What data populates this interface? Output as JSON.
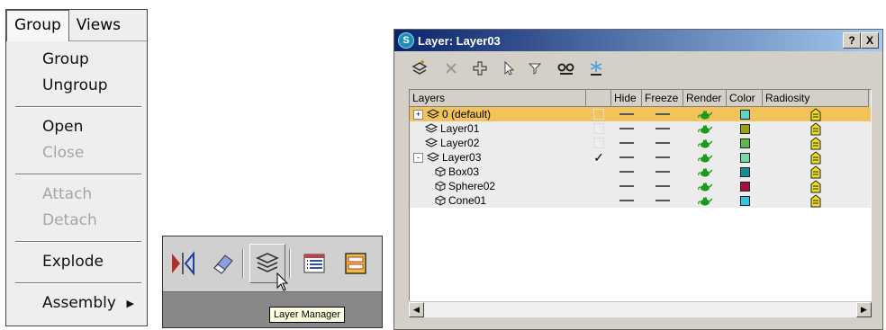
{
  "menu": {
    "bar": [
      "Group",
      "Views"
    ],
    "items": [
      {
        "label": "Group",
        "disabled": false
      },
      {
        "label": "Ungroup",
        "disabled": false
      },
      {
        "label": "Open",
        "disabled": false
      },
      {
        "label": "Close",
        "disabled": true
      },
      {
        "label": "Attach",
        "disabled": true
      },
      {
        "label": "Detach",
        "disabled": true
      },
      {
        "label": "Explode",
        "disabled": false
      },
      {
        "label": "Assembly",
        "disabled": false,
        "submenu": true
      }
    ]
  },
  "toolbar": {
    "buttons": [
      "mirror-icon",
      "eraser-icon",
      "layer-manager-icon",
      "list-view-icon",
      "window-icon"
    ],
    "tooltip": "Layer Manager"
  },
  "dialog": {
    "title": "Layer: Layer03",
    "title_buttons": [
      "?",
      "X"
    ],
    "tools": [
      "new-layer-icon",
      "delete-icon",
      "add-selection-icon",
      "select-icon",
      "highlight-icon",
      "hide-all-icon",
      "freeze-all-icon"
    ],
    "columns": [
      "Layers",
      "",
      "Hide",
      "Freeze",
      "Render",
      "Color",
      "Radiosity"
    ],
    "rows": [
      {
        "name": "0 (default)",
        "level": 0,
        "expander": "+",
        "selected": true,
        "current": false,
        "color": "#5ad6c8"
      },
      {
        "name": "Layer01",
        "level": 0,
        "expander": "",
        "selected": false,
        "current": false,
        "color": "#9aa01c"
      },
      {
        "name": "Layer02",
        "level": 0,
        "expander": "",
        "selected": false,
        "current": false,
        "color": "#5cb84a"
      },
      {
        "name": "Layer03",
        "level": 0,
        "expander": "-",
        "selected": false,
        "current": true,
        "color": "#7ad8a4"
      },
      {
        "name": "Box03",
        "level": 1,
        "expander": "",
        "selected": false,
        "current": false,
        "color": "#1a8a98"
      },
      {
        "name": "Sphere02",
        "level": 1,
        "expander": "",
        "selected": false,
        "current": false,
        "color": "#a01040"
      },
      {
        "name": "Cone01",
        "level": 1,
        "expander": "",
        "selected": false,
        "current": false,
        "color": "#3cc0e0"
      }
    ],
    "checkmark": "✓",
    "colors": {
      "titlebar": "#0a246a",
      "selection": "#f2c35a",
      "render_teapot": "#1c9a1c",
      "radiosity": "#f0e020"
    }
  }
}
